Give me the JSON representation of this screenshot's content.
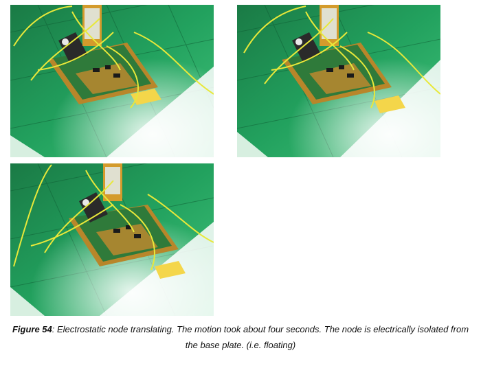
{
  "figure": {
    "label": "Figure 54",
    "caption_text": ": Electrostatic node translating.  The motion took about four seconds.  The node is electrically isolated from the base plate.  (i.e. floating)"
  },
  "photos": [
    {
      "id": "frame-1"
    },
    {
      "id": "frame-2"
    },
    {
      "id": "frame-3"
    }
  ],
  "colors": {
    "plate_green": "#1f9b5a",
    "board_green": "#2f7a3a",
    "kapton": "#d49b2c",
    "wire": "#e8e83a",
    "pad": "#f4d64a"
  }
}
